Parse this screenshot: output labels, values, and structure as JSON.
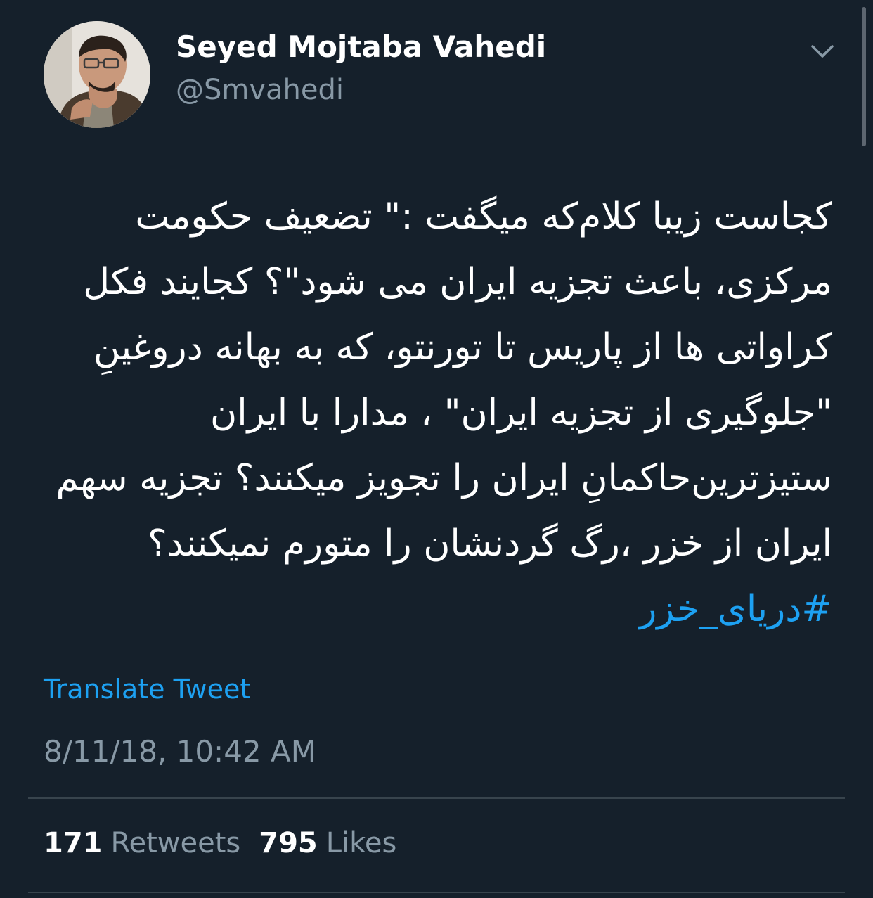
{
  "author": {
    "display_name": "Seyed Mojtaba Vahedi",
    "handle": "@Smvahedi"
  },
  "tweet": {
    "text": "کجاست زیبا کلام‌که میگفت :\" تضعیف حکومت مرکزی، باعث تجزیه ایران می شود\"؟ کجایند فکل کراواتی ها  از پاریس تا تورنتو، که به بهانه دروغینِ \"جلوگیری از تجزیه ایران\" ، مدارا با ایران ستیزترین‌حاکمانِ ایران را  تجویز میکنند؟ تجزیه سهم ایران از خزر ،رگ گردنشان را متورم نمیکنند؟",
    "hashtag": "#دریای_خزر",
    "translate_label": "Translate Tweet",
    "timestamp": "8/11/18, 10:42 AM"
  },
  "stats": {
    "retweets_count": "171",
    "retweets_label": "Retweets",
    "likes_count": "795",
    "likes_label": "Likes"
  },
  "icons": {
    "menu": "chevron-down-icon"
  },
  "colors": {
    "background": "#15202b",
    "link": "#1da1f2",
    "secondary_text": "#8899a6",
    "primary_text": "#ffffff",
    "divider": "#38444d"
  }
}
